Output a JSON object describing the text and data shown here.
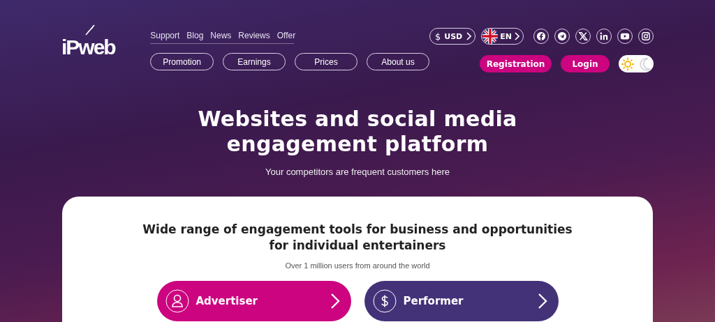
{
  "logo": {
    "text": "iPweb"
  },
  "top_links": [
    "Support",
    "Blog",
    "News",
    "Reviews",
    "Offer"
  ],
  "nav_pills": [
    "Promotion",
    "Earnings",
    "Prices",
    "About us"
  ],
  "currency": {
    "symbol": "$",
    "label": "USD"
  },
  "language": {
    "label": "EN"
  },
  "socials": [
    {
      "kind": "facebook"
    },
    {
      "kind": "telegram"
    },
    {
      "kind": "x"
    },
    {
      "kind": "linkedin"
    },
    {
      "kind": "youtube"
    },
    {
      "kind": "instagram"
    }
  ],
  "auth_buttons": [
    "Registration",
    "Login"
  ],
  "theme_toggle": [
    {
      "kind": "light",
      "selected": true
    },
    {
      "kind": "dark",
      "selected": false
    }
  ],
  "hero": {
    "title": "Websites and social media engagement platform",
    "subtitle": "Your competitors are frequent customers here"
  },
  "card": {
    "title": "Wide range of engagement tools for business and opportunities for individual entertainers",
    "subtitle": "Over 1 million users from around the world",
    "roles": [
      {
        "label": "Advertiser",
        "kind": "person",
        "color": "#cc047f"
      },
      {
        "label": "Performer",
        "kind": "dollar",
        "color": "#433278"
      }
    ]
  }
}
